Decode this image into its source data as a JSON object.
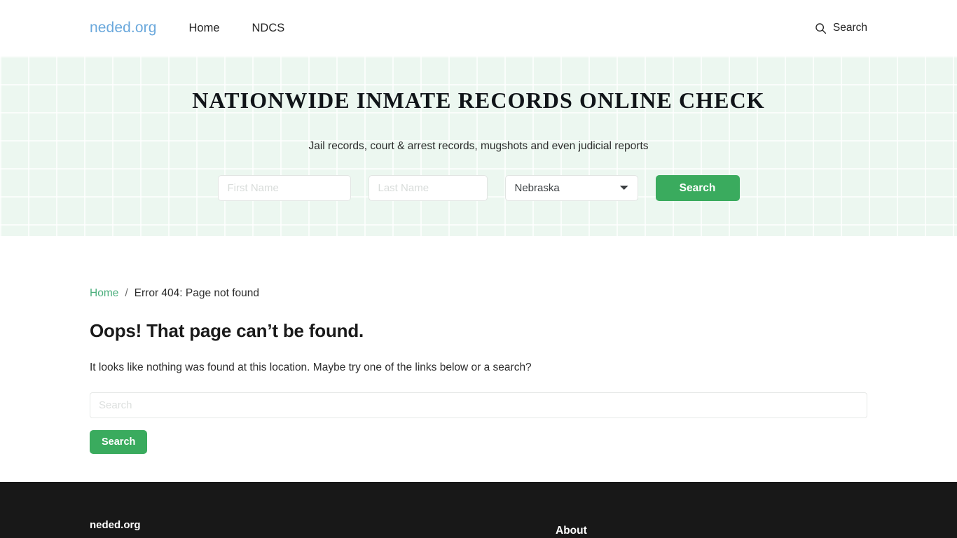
{
  "header": {
    "brand": "neded.org",
    "nav": [
      {
        "label": "Home"
      },
      {
        "label": "NDCS"
      }
    ],
    "search": {
      "label": "Search",
      "icon": "search-icon"
    }
  },
  "hero": {
    "title": "NATIONWIDE INMATE RECORDS ONLINE CHECK",
    "subtitle": "Jail records, court & arrest records, mugshots and even judicial reports",
    "form": {
      "first_name_placeholder": "First Name",
      "first_name_value": "",
      "last_name_placeholder": "Last Name",
      "last_name_value": "",
      "state_selected": "Nebraska",
      "state_options": [
        "Nebraska"
      ],
      "submit_label": "Search"
    }
  },
  "main": {
    "breadcrumb": {
      "home": "Home",
      "separator": "/",
      "current": "Error 404: Page not found"
    },
    "title": "Oops! That page can’t be found.",
    "body": "It looks like nothing was found at this location. Maybe try one of the links below or a search?",
    "search_placeholder": "Search",
    "search_value": "",
    "search_button": "Search"
  },
  "footer": {
    "brand": "neded.org",
    "about_heading": "About"
  },
  "colors": {
    "accent_green": "#3aab5e",
    "link_green": "#4caf7d",
    "brand_blue": "#6aa8dc",
    "hero_bg": "#ecf7f0",
    "footer_bg": "#181818"
  }
}
